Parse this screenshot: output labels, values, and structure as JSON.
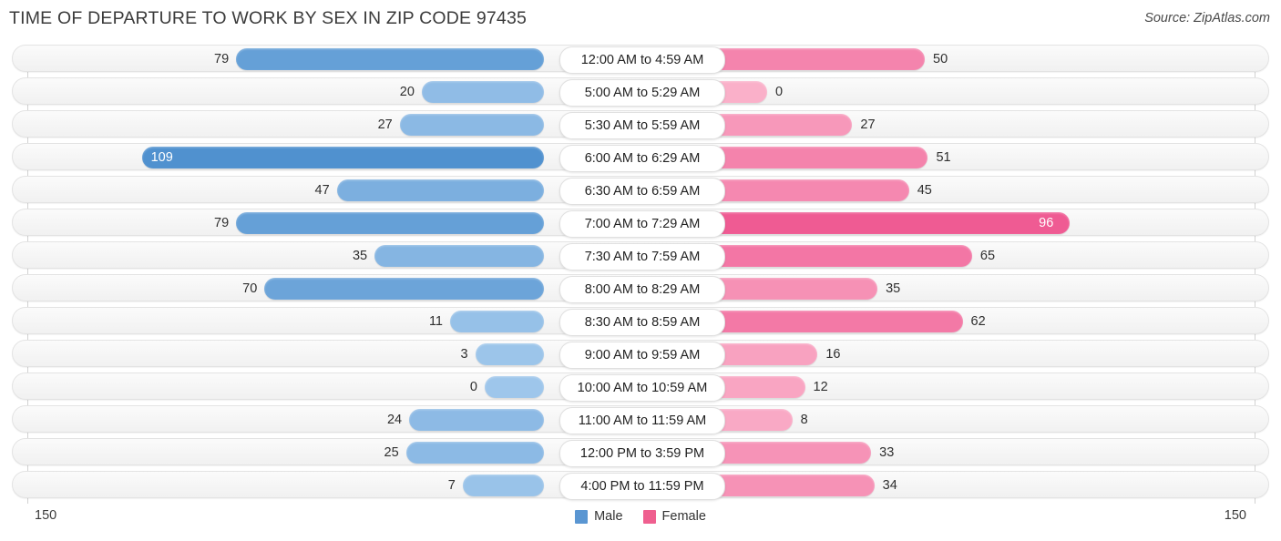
{
  "header": {
    "title": "TIME OF DEPARTURE TO WORK BY SEX IN ZIP CODE 97435",
    "source": "Source: ZipAtlas.com"
  },
  "legend": {
    "male_label": "Male",
    "female_label": "Female",
    "male_color": "#5a96d2",
    "female_color": "#ef5f8f"
  },
  "axis": {
    "left_tick": "150",
    "right_tick": "150",
    "max": 150
  },
  "chart_data": {
    "type": "bar",
    "orientation": "horizontal-diverging",
    "title": "TIME OF DEPARTURE TO WORK BY SEX IN ZIP CODE 97435",
    "xlabel": "",
    "ylabel": "",
    "xlim": [
      150,
      150
    ],
    "grid": false,
    "legend_position": "bottom-center",
    "categories": [
      "12:00 AM to 4:59 AM",
      "5:00 AM to 5:29 AM",
      "5:30 AM to 5:59 AM",
      "6:00 AM to 6:29 AM",
      "6:30 AM to 6:59 AM",
      "7:00 AM to 7:29 AM",
      "7:30 AM to 7:59 AM",
      "8:00 AM to 8:29 AM",
      "8:30 AM to 8:59 AM",
      "9:00 AM to 9:59 AM",
      "10:00 AM to 10:59 AM",
      "11:00 AM to 11:59 AM",
      "12:00 PM to 3:59 PM",
      "4:00 PM to 11:59 PM"
    ],
    "series": [
      {
        "name": "Male",
        "values": [
          79,
          20,
          27,
          109,
          47,
          79,
          35,
          70,
          11,
          3,
          0,
          24,
          25,
          7
        ]
      },
      {
        "name": "Female",
        "values": [
          50,
          0,
          27,
          51,
          45,
          96,
          65,
          35,
          62,
          16,
          12,
          8,
          33,
          34
        ]
      }
    ]
  },
  "rows": [
    {
      "label": "12:00 AM to 4:59 AM",
      "male": "79",
      "female": "50"
    },
    {
      "label": "5:00 AM to 5:29 AM",
      "male": "20",
      "female": "0"
    },
    {
      "label": "5:30 AM to 5:59 AM",
      "male": "27",
      "female": "27"
    },
    {
      "label": "6:00 AM to 6:29 AM",
      "male": "109",
      "female": "51"
    },
    {
      "label": "6:30 AM to 6:59 AM",
      "male": "47",
      "female": "45"
    },
    {
      "label": "7:00 AM to 7:29 AM",
      "male": "79",
      "female": "96"
    },
    {
      "label": "7:30 AM to 7:59 AM",
      "male": "35",
      "female": "65"
    },
    {
      "label": "8:00 AM to 8:29 AM",
      "male": "70",
      "female": "35"
    },
    {
      "label": "8:30 AM to 8:59 AM",
      "male": "11",
      "female": "62"
    },
    {
      "label": "9:00 AM to 9:59 AM",
      "male": "3",
      "female": "16"
    },
    {
      "label": "10:00 AM to 10:59 AM",
      "male": "0",
      "female": "12"
    },
    {
      "label": "11:00 AM to 11:59 AM",
      "male": "24",
      "female": "8"
    },
    {
      "label": "12:00 PM to 3:59 PM",
      "male": "25",
      "female": "33"
    },
    {
      "label": "4:00 PM to 11:59 PM",
      "male": "7",
      "female": "34"
    }
  ]
}
